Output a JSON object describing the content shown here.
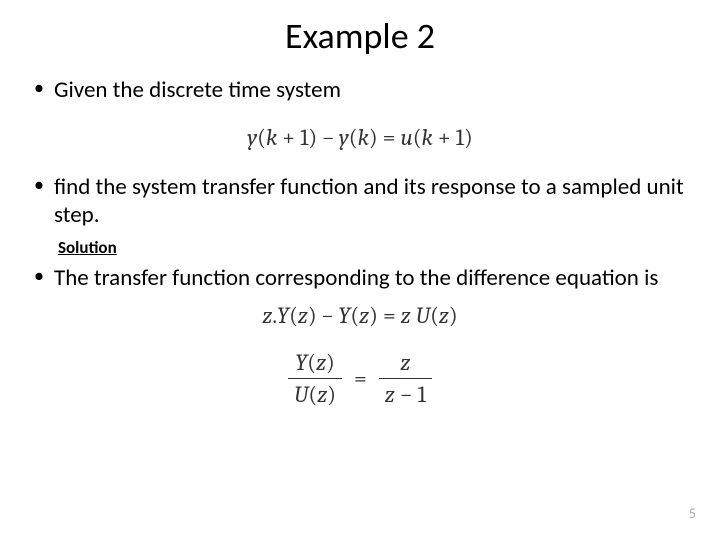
{
  "title": "Example 2",
  "bullets": {
    "b1": "Given the discrete time system",
    "b2": "find the system transfer function and its response to a sampled unit step.",
    "b3": "The transfer function corresponding to the difference equation is"
  },
  "solution_label": "Solution",
  "equations": {
    "diff_eq": "y(k + 1) − y(k) = u(k + 1)",
    "ztrans": "z.Y(z) − Y(z) = z U(z)",
    "tf_lhs_num": "Y(z)",
    "tf_lhs_den": "U(z)",
    "tf_eq": "=",
    "tf_rhs_num": "z",
    "tf_rhs_den": "z − 1"
  },
  "page_number": "5"
}
